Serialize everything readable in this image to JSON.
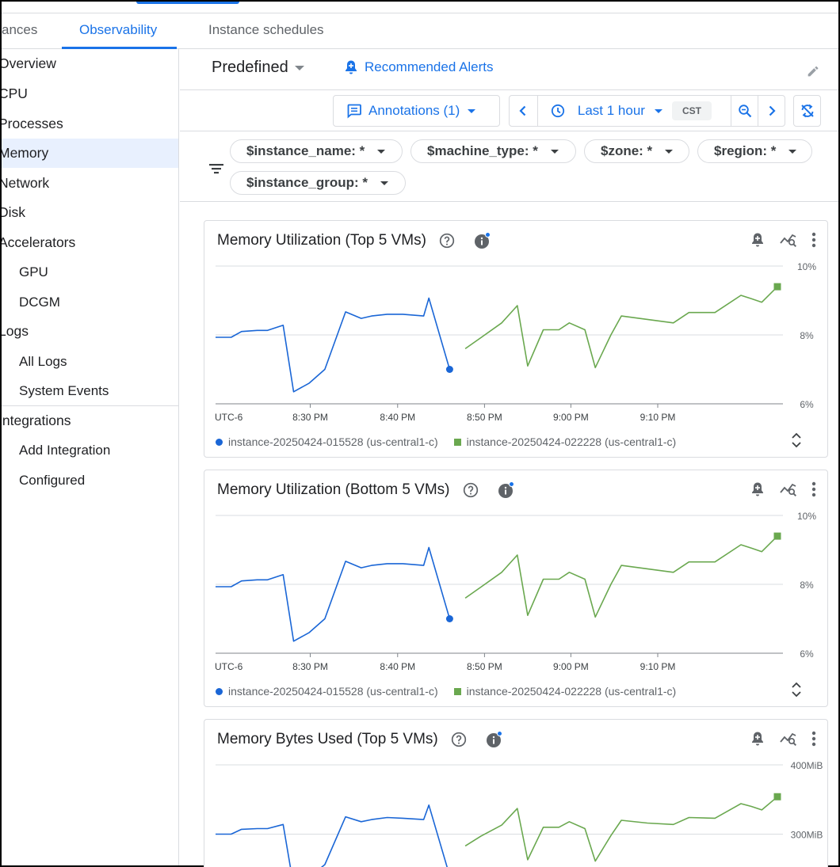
{
  "tabs": [
    {
      "label": "ances"
    },
    {
      "label": "Observability"
    },
    {
      "label": "Instance schedules"
    }
  ],
  "sidebar": {
    "items": [
      {
        "label": "Overview"
      },
      {
        "label": "CPU"
      },
      {
        "label": "Processes"
      },
      {
        "label": "Memory"
      },
      {
        "label": "Network"
      },
      {
        "label": "Disk"
      },
      {
        "label": "Accelerators"
      },
      {
        "label": "GPU"
      },
      {
        "label": "DCGM"
      },
      {
        "label": "Logs"
      },
      {
        "label": "All Logs"
      },
      {
        "label": "System Events"
      },
      {
        "label": "Integrations"
      },
      {
        "label": "Add Integration"
      },
      {
        "label": "Configured"
      }
    ]
  },
  "header": {
    "dashboard": "Predefined",
    "recommended_alerts": "Recommended Alerts"
  },
  "toolbar": {
    "annotations": "Annotations (1)",
    "time_range": "Last 1 hour",
    "timezone": "CST"
  },
  "filters": [
    {
      "label": "$instance_name: *"
    },
    {
      "label": "$machine_type: *"
    },
    {
      "label": "$zone: *"
    },
    {
      "label": "$region: *"
    },
    {
      "label": "$instance_group: *"
    }
  ],
  "colors": {
    "accent": "#1a73e8",
    "series_a": "#1a66d6",
    "series_b": "#6aa84f"
  },
  "chart_data": [
    {
      "type": "line",
      "title": "Memory Utilization (Top 5 VMs)",
      "timezone_label": "UTC-6",
      "x_ticks": [
        "8:30 PM",
        "8:40 PM",
        "8:50 PM",
        "9:00 PM",
        "9:10 PM"
      ],
      "y_ticks": [
        "10%",
        "8%",
        "6%"
      ],
      "ylim": [
        6,
        10
      ],
      "xlim": [
        20.17,
        21.25
      ],
      "series": [
        {
          "name": "instance-20250424-015528 (us-central1-c)",
          "x": [
            20.17,
            20.2,
            20.22,
            20.25,
            20.27,
            20.3,
            20.32,
            20.35,
            20.38,
            20.42,
            20.45,
            20.47,
            20.5,
            20.53,
            20.57,
            20.58,
            20.62
          ],
          "y": [
            7.93,
            7.93,
            8.1,
            8.13,
            8.13,
            8.28,
            6.35,
            6.6,
            7.0,
            8.67,
            8.48,
            8.55,
            8.6,
            8.6,
            8.55,
            9.07,
            7.0
          ]
        },
        {
          "name": "instance-20250424-022228 (us-central1-c)",
          "x": [
            20.65,
            20.68,
            20.72,
            20.75,
            20.77,
            20.8,
            20.83,
            20.85,
            20.88,
            20.9,
            20.93,
            20.95,
            21.0,
            21.05,
            21.08,
            21.13,
            21.18,
            21.2,
            21.22,
            21.25
          ],
          "y": [
            7.6,
            7.92,
            8.35,
            8.85,
            7.1,
            8.15,
            8.15,
            8.35,
            8.15,
            7.05,
            8.0,
            8.55,
            8.45,
            8.35,
            8.65,
            8.65,
            9.15,
            9.05,
            8.95,
            9.4
          ]
        }
      ]
    },
    {
      "type": "line",
      "title": "Memory Utilization (Bottom 5 VMs)",
      "timezone_label": "UTC-6",
      "x_ticks": [
        "8:30 PM",
        "8:40 PM",
        "8:50 PM",
        "9:00 PM",
        "9:10 PM"
      ],
      "y_ticks": [
        "10%",
        "8%",
        "6%"
      ],
      "ylim": [
        6,
        10
      ],
      "xlim": [
        20.17,
        21.25
      ],
      "series": [
        {
          "name": "instance-20250424-015528 (us-central1-c)",
          "x": [
            20.17,
            20.2,
            20.22,
            20.25,
            20.27,
            20.3,
            20.32,
            20.35,
            20.38,
            20.42,
            20.45,
            20.47,
            20.5,
            20.53,
            20.57,
            20.58,
            20.62
          ],
          "y": [
            7.93,
            7.93,
            8.1,
            8.13,
            8.13,
            8.28,
            6.35,
            6.6,
            7.0,
            8.67,
            8.48,
            8.55,
            8.6,
            8.6,
            8.55,
            9.07,
            7.0
          ]
        },
        {
          "name": "instance-20250424-022228 (us-central1-c)",
          "x": [
            20.65,
            20.68,
            20.72,
            20.75,
            20.77,
            20.8,
            20.83,
            20.85,
            20.88,
            20.9,
            20.93,
            20.95,
            21.0,
            21.05,
            21.08,
            21.13,
            21.18,
            21.2,
            21.22,
            21.25
          ],
          "y": [
            7.6,
            7.92,
            8.35,
            8.85,
            7.1,
            8.15,
            8.15,
            8.35,
            8.15,
            7.05,
            8.0,
            8.55,
            8.45,
            8.35,
            8.65,
            8.65,
            9.15,
            9.05,
            8.95,
            9.4
          ]
        }
      ]
    },
    {
      "type": "line",
      "title": "Memory Bytes Used (Top 5 VMs)",
      "y_ticks": [
        "400MiB",
        "300MiB"
      ],
      "ylim": [
        200,
        400
      ],
      "xlim": [
        20.17,
        21.25
      ],
      "series": [
        {
          "name": "instance-20250424-015528 (us-central1-c)",
          "x": [
            20.17,
            20.2,
            20.22,
            20.25,
            20.27,
            20.3,
            20.32,
            20.35,
            20.38,
            20.42,
            20.45,
            20.47,
            20.5,
            20.53,
            20.57,
            20.58,
            20.62
          ],
          "y": [
            300,
            300,
            307,
            308,
            308,
            314,
            225,
            238,
            256,
            325,
            318,
            321,
            324,
            323,
            321,
            342,
            240
          ]
        },
        {
          "name": "instance-20250424-022228 (us-central1-c)",
          "x": [
            20.65,
            20.68,
            20.72,
            20.75,
            20.77,
            20.8,
            20.83,
            20.85,
            20.88,
            20.9,
            20.93,
            20.95,
            21.0,
            21.05,
            21.08,
            21.13,
            21.18,
            21.2,
            21.22,
            21.25
          ],
          "y": [
            283,
            297,
            313,
            337,
            263,
            310,
            310,
            318,
            308,
            261,
            298,
            320,
            316,
            314,
            324,
            323,
            344,
            340,
            335,
            354
          ]
        }
      ]
    }
  ]
}
